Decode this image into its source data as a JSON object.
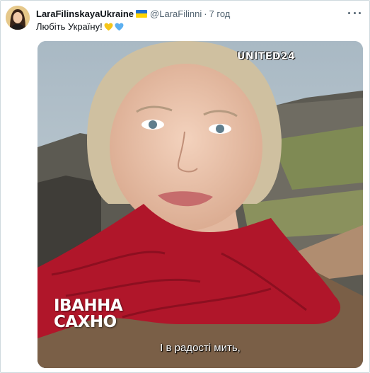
{
  "tweet": {
    "display_name": "LaraFilinskayaUkraine",
    "flag_icon": "ukraine-flag-icon",
    "handle": "@LaraFilinni",
    "separator": "·",
    "time": "7 год",
    "text": "Любіть Україну!",
    "emojis": [
      "yellow-heart-icon",
      "blue-heart-icon"
    ],
    "more_icon": "more-dots-icon"
  },
  "media": {
    "brand_label": "UNITED24",
    "name_line1": "ІВАННА",
    "name_line2": "САХНО",
    "subtitle": "І в радості мить,"
  },
  "colors": {
    "flag_blue": "#1f6fd1",
    "flag_yellow": "#ffd500",
    "heart_yellow": "#f5c518",
    "heart_blue": "#5db0f0",
    "scarf_red": "#b0162a"
  }
}
